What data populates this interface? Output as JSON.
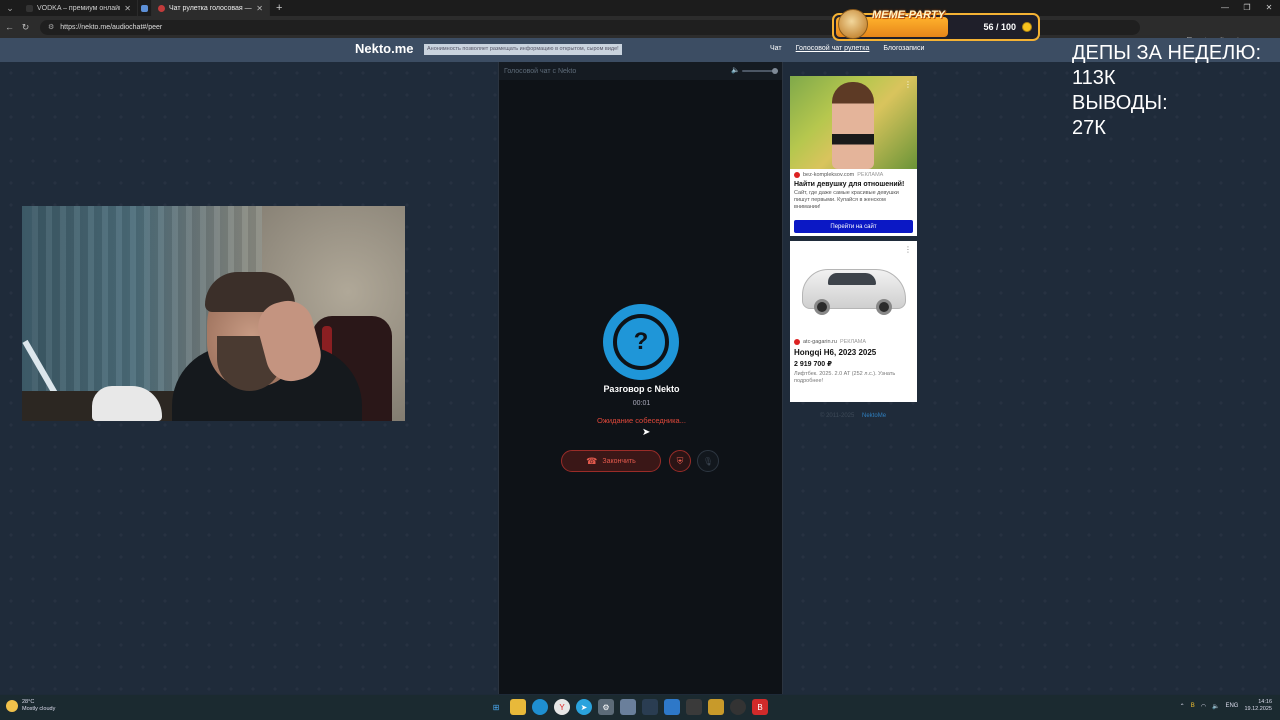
{
  "browser": {
    "tabs": [
      {
        "title": "VODKA – премиум онлайн-казино",
        "favicon_color": "#333333"
      },
      {
        "title": "",
        "favicon_color": "#5c8fd6"
      },
      {
        "title": "Чат рулетка голосовая — Nekto",
        "favicon_color": "#c23b3b"
      }
    ],
    "url": "https://nekto.me/audiochat#/peer"
  },
  "site": {
    "logo": "Nekto.me",
    "tagline": "Анонимность позволяет размещать информацию в открытом, сыром виде!",
    "nav": [
      "Чат",
      "Голосовой чат рулетка",
      "Блогозаписи"
    ]
  },
  "meme_party": {
    "title": "MEME-PARTY",
    "count": "56 / 100",
    "progress_fraction": 0.56
  },
  "chat": {
    "header": "Голосовой чат с Nekto",
    "avatar_symbol": "?",
    "title": "Разговор с Nekto",
    "timer": "00:01",
    "status": "Ожидание собеседника...",
    "end_button": "Закончить"
  },
  "ads": {
    "ad1": {
      "domain": "bez-kompleksov.com",
      "label": "РЕКЛАМА",
      "headline": "Найти девушку для отношений!",
      "description": "Сайт, где даже самые красивые девушки пишут первыми. Купайся в женском внимании!",
      "cta": "Перейти на сайт"
    },
    "ad2": {
      "domain": "atc-gagarin.ru",
      "label": "РЕКЛАМА",
      "headline": "Hongqi H6, 2023 2025",
      "price": "2 919 700 ₽",
      "description": "Лифтбек. 2025. 2.0 AT (252 л.с.). Узнать подробнее!"
    },
    "footer": "© 2011-2025",
    "footer_link": "NektoMe"
  },
  "overlay": {
    "line1": "ДЕПЫ ЗА НЕДЕЛЮ:",
    "line2": "113К",
    "line3": "ВЫВОДЫ:",
    "line4": "27К"
  },
  "taskbar": {
    "temperature": "28°C",
    "weather": "Mostly cloudy",
    "lang": "ENG",
    "time": "14:16",
    "date": "19.12.2025"
  }
}
